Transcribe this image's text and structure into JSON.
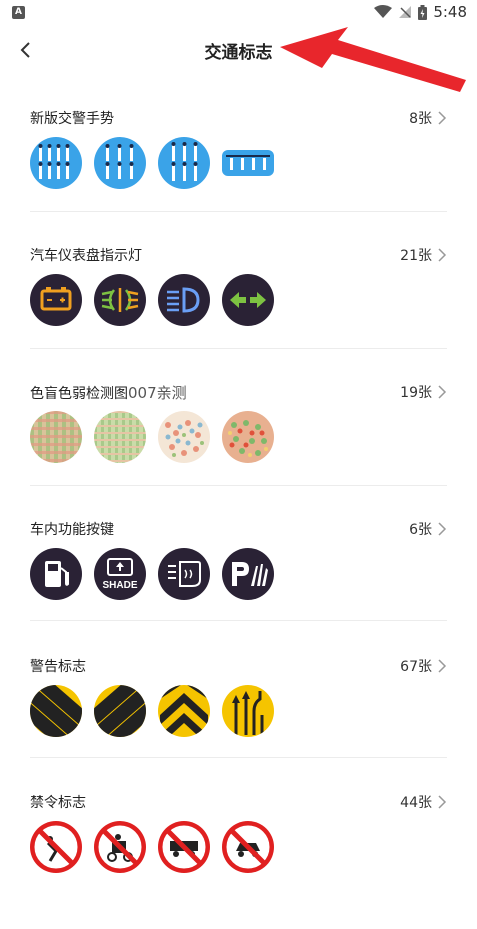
{
  "statusbar": {
    "time": "5:48",
    "app_icon_letter": "A"
  },
  "header": {
    "title": "交通标志"
  },
  "sections": [
    {
      "title": "新版交警手势",
      "count": "8张"
    },
    {
      "title": "汽车仪表盘指示灯",
      "count": "21张"
    },
    {
      "title": "色盲色弱检测图",
      "subtitle": "007亲测",
      "count": "19张"
    },
    {
      "title": "车内功能按键",
      "count": "6张",
      "shade_label": "SHADE"
    },
    {
      "title": "警告标志",
      "count": "67张"
    },
    {
      "title": "禁令标志",
      "count": "44张"
    }
  ],
  "colors": {
    "accent_blue": "#3aa3e8",
    "icon_dark": "#2a2235",
    "warning_yellow": "#f5c400",
    "prohibit_red": "#e02020",
    "annotation_red": "#e8262c"
  }
}
